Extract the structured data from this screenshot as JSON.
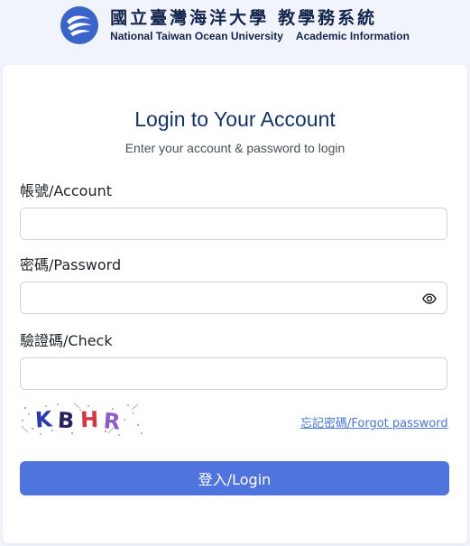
{
  "header": {
    "school_name_zh": "國立臺灣海洋大學",
    "system_name_zh": "教學務系統",
    "school_name_en": "National Taiwan Ocean University",
    "system_name_en": "Academic Information",
    "logo_icon": "ntou-wave-logo-icon"
  },
  "login": {
    "title": "Login to Your Account",
    "subtitle": "Enter your account & password to login",
    "account_label": "帳號/Account",
    "account_value": "",
    "password_label": "密碼/Password",
    "password_value": "",
    "password_toggle_icon": "eye-icon",
    "check_label": "驗證碼/Check",
    "check_value": "",
    "captcha_text": "KBHR",
    "forgot_link": "忘記密碼/Forgot password",
    "login_button": "登入/Login"
  },
  "colors": {
    "page_bg": "#f1f4fa",
    "brand_blue": "#3a64c9",
    "title_navy": "#12336a",
    "button_blue": "#4f74dd",
    "link_blue": "#4a76d7"
  }
}
